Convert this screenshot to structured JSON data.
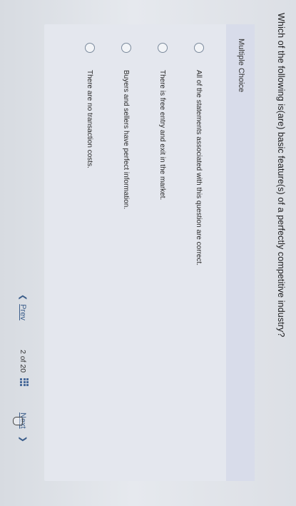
{
  "question": {
    "text": "Which of the following is(are) basic feature(s) of a perfectly competitive industry?"
  },
  "panel": {
    "type_label": "Multiple Choice"
  },
  "options": [
    {
      "label": "All of the statements associated with this question are correct.",
      "selected": false
    },
    {
      "label": "There is free entry and exit in the market.",
      "selected": false
    },
    {
      "label": "Buyers and sellers have perfect information.",
      "selected": false
    },
    {
      "label": "There are no transaction costs.",
      "selected": false
    }
  ],
  "navigation": {
    "prev_label": "Prev",
    "prev_icon": "chevron-left-icon",
    "page_indicator": "2 of 20",
    "grid_icon": "grid-icon",
    "next_label": "Next",
    "next_icon": "chevron-right-icon"
  },
  "colors": {
    "panel_background": "#e4e7ee",
    "panel_header": "#d8dcea",
    "link": "#3b5d8a",
    "radio_border": "#7b8a9c"
  }
}
